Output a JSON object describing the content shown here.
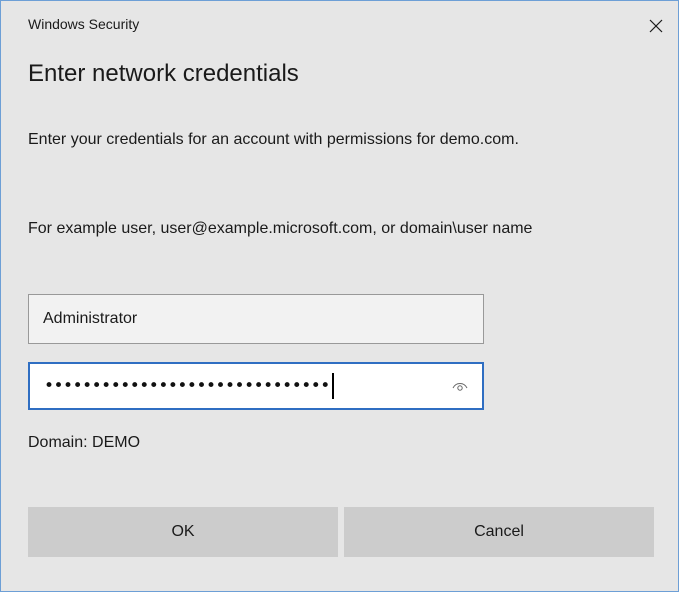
{
  "window": {
    "app_title": "Windows Security",
    "close_icon": "close-icon"
  },
  "dialog": {
    "heading": "Enter network credentials",
    "description": "Enter your credentials for an account with permissions for demo.com.",
    "example": "For example user, user@example.microsoft.com, or domain\\user name",
    "username_value": "Administrator",
    "password_mask": "••••••••••••••••••••••••••••••",
    "reveal_icon": "eye-icon",
    "domain_label": "Domain: DEMO"
  },
  "buttons": {
    "ok_label": "OK",
    "cancel_label": "Cancel"
  },
  "colors": {
    "background": "#e6e6e6",
    "accent_border": "#2f6ec2",
    "button_bg": "#cccccc"
  }
}
